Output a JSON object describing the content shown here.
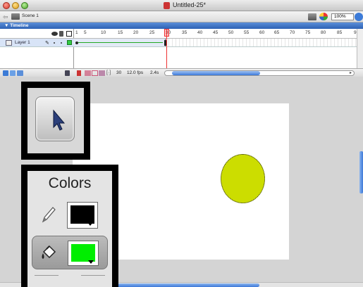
{
  "window": {
    "title": "Untitled-25*"
  },
  "scene_bar": {
    "scene_label": "Scene 1",
    "zoom": "100%"
  },
  "timeline": {
    "label": "▼ Timeline",
    "layer_name": "Layer 1",
    "ruler_ticks": [
      "1",
      "5",
      "10",
      "15",
      "20",
      "25",
      "30",
      "35",
      "40",
      "45",
      "50",
      "55",
      "60",
      "65",
      "70",
      "75",
      "80",
      "85",
      "9"
    ],
    "current_frame": "30",
    "frame_rate": "12.0 fps",
    "elapsed_time": "2.4s",
    "layer_color": "#33cc44"
  },
  "stage": {
    "ellipse_fill": "#ccdd00",
    "background": "#ffffff"
  },
  "tools": {
    "colors_title": "Colors",
    "stroke_color": "#000000",
    "fill_color": "#00ee00"
  }
}
